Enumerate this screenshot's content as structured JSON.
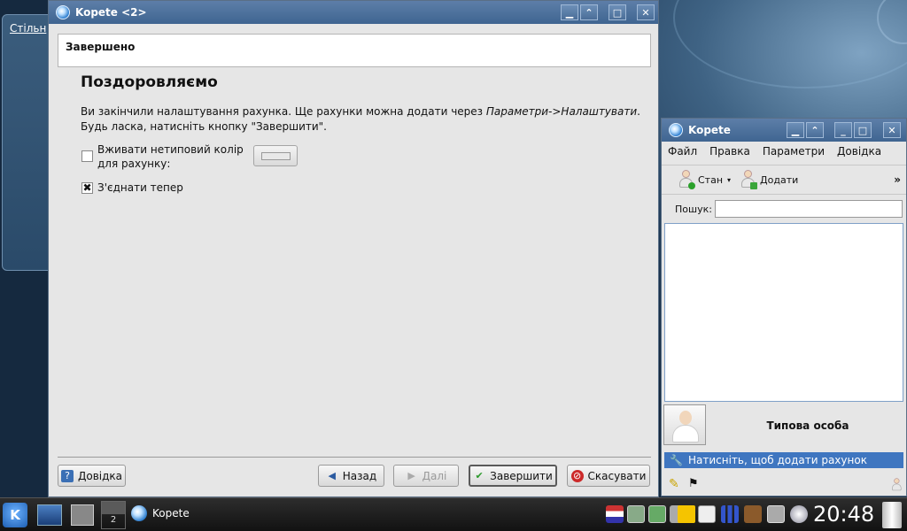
{
  "wizard": {
    "title": "Kopete <2>",
    "header": "Завершено",
    "heading": "Поздоровляємо",
    "para_line1_prefix": "Ви закінчили налаштування рахунка. Ще рахунки можна додати через ",
    "para_line1_italic": "Параметри->Налаштувати",
    "para_line1_suffix": ".",
    "para_line2": "Будь ласка, натисніть кнопку \"Завершити\".",
    "custom_color_label_1": "Вживати нетиповий колір",
    "custom_color_label_2": "для рахунку:",
    "custom_color_checked": "",
    "connect_now_label": "З'єднати тепер",
    "connect_now_checked": "✖",
    "buttons": {
      "help": "Довідка",
      "back": "Назад",
      "next": "Далі",
      "finish": "Завершити",
      "cancel": "Скасувати"
    }
  },
  "kopete": {
    "title": "Kopete",
    "menu": [
      "Файл",
      "Правка",
      "Параметри",
      "Довідка"
    ],
    "toolbar": {
      "status": "Стан",
      "add": "Додати",
      "more": "»"
    },
    "search_label": "Пошук:",
    "search_value": "",
    "identity": "Типова особа",
    "add_account_hint": "Натисніть, щоб додати рахунок"
  },
  "background": {
    "window_label": "Стільн"
  },
  "taskbar": {
    "task_label": "Kopete",
    "desktop_number": "2",
    "clock": "20:48"
  },
  "colors": {
    "titlebar": "#4a6f9c",
    "accent": "#3f76c0",
    "window_bg": "#e6e6e6"
  }
}
